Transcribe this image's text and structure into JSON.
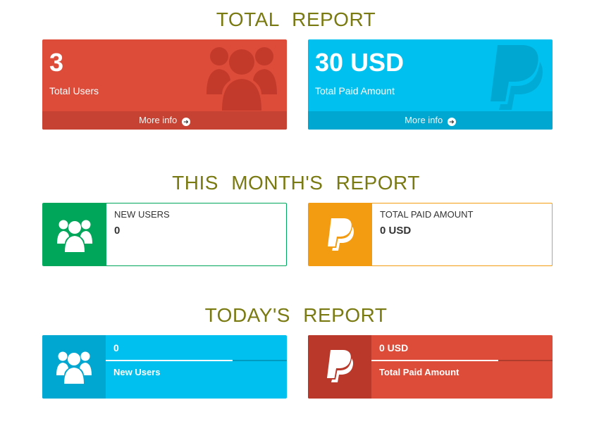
{
  "total_report": {
    "title": "TOTAL REPORT",
    "users_box": {
      "value": "3",
      "label": "Total Users",
      "more_info": "More info",
      "icon": "users-icon"
    },
    "paid_box": {
      "value": "30 USD",
      "label": "Total Paid Amount",
      "more_info": "More info",
      "icon": "paypal-icon"
    }
  },
  "month_report": {
    "title": "THIS MONTH'S REPORT",
    "users_box": {
      "label": "NEW USERS",
      "value": "0",
      "icon": "users-icon"
    },
    "paid_box": {
      "label": "TOTAL PAID AMOUNT",
      "value": "0 USD",
      "icon": "paypal-icon"
    }
  },
  "today_report": {
    "title": "TODAY'S REPORT",
    "users_box": {
      "value": "0",
      "label": "New Users",
      "progress": 0.7,
      "icon": "users-icon"
    },
    "paid_box": {
      "value": "0 USD",
      "label": "Total Paid Amount",
      "progress": 0.7,
      "icon": "paypal-icon"
    }
  },
  "colors": {
    "title": "#7a7a12",
    "red": "#dd4b39",
    "blue": "#00c0ef",
    "green": "#00a65a",
    "orange": "#f39c12"
  }
}
